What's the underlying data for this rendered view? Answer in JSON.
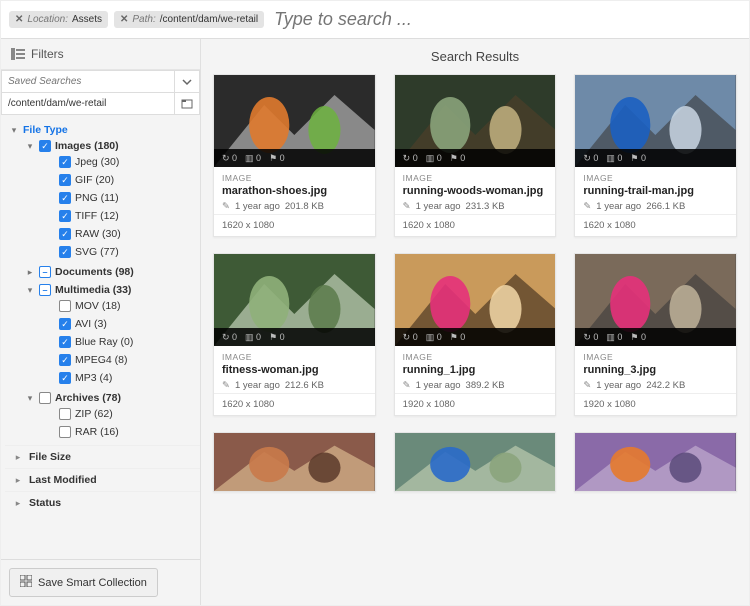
{
  "topbar": {
    "tags": [
      {
        "key": "Location",
        "value": "Assets"
      },
      {
        "key": "Path",
        "value": "/content/dam/we-retail"
      }
    ],
    "search_placeholder": "Type to search ..."
  },
  "sidebar": {
    "filters_label": "Filters",
    "saved_searches_placeholder": "Saved Searches",
    "path_value": "/content/dam/we-retail",
    "tree": {
      "file_type": {
        "label": "File Type",
        "images": {
          "label": "Images (180)",
          "checked": true,
          "children": [
            {
              "label": "Jpeg (30)",
              "checked": true
            },
            {
              "label": "GIF (20)",
              "checked": true
            },
            {
              "label": "PNG (11)",
              "checked": true
            },
            {
              "label": "TIFF (12)",
              "checked": true
            },
            {
              "label": "RAW (30)",
              "checked": true
            },
            {
              "label": "SVG (77)",
              "checked": true
            }
          ]
        },
        "documents": {
          "label": "Documents (98)",
          "mixed": true
        },
        "multimedia": {
          "label": "Multimedia (33)",
          "mixed": true,
          "children": [
            {
              "label": "MOV (18)",
              "checked": false
            },
            {
              "label": "AVI (3)",
              "checked": true
            },
            {
              "label": "Blue Ray (0)",
              "checked": true
            },
            {
              "label": "MPEG4 (8)",
              "checked": true
            },
            {
              "label": "MP3 (4)",
              "checked": true
            }
          ]
        },
        "archives": {
          "label": "Archives (78)",
          "checked": false,
          "children": [
            {
              "label": "ZIP (62)",
              "checked": false
            },
            {
              "label": "RAR (16)",
              "checked": false
            }
          ]
        }
      },
      "sections": [
        "File Size",
        "Last Modified",
        "Status"
      ]
    },
    "save_button": "Save Smart Collection"
  },
  "results": {
    "title": "Search Results",
    "eyebrow": "IMAGE",
    "qa_values": {
      "a": "0",
      "b": "0",
      "c": "0"
    },
    "cards": [
      {
        "name": "marathon-shoes.jpg",
        "age": "1 year ago",
        "size": "201.8 KB",
        "dims": "1620 x 1080",
        "palette": "run1"
      },
      {
        "name": "running-woods-woman.jpg",
        "age": "1 year ago",
        "size": "231.3 KB",
        "dims": "1620 x 1080",
        "palette": "run2"
      },
      {
        "name": "running-trail-man.jpg",
        "age": "1 year ago",
        "size": "266.1 KB",
        "dims": "1620 x 1080",
        "palette": "run3"
      },
      {
        "name": "fitness-woman.jpg",
        "age": "1 year ago",
        "size": "212.6 KB",
        "dims": "1620 x 1080",
        "palette": "run4"
      },
      {
        "name": "running_1.jpg",
        "age": "1 year ago",
        "size": "389.2 KB",
        "dims": "1920 x 1080",
        "palette": "run5"
      },
      {
        "name": "running_3.jpg",
        "age": "1 year ago",
        "size": "242.2 KB",
        "dims": "1920 x 1080",
        "palette": "run6"
      },
      {
        "name": "",
        "partial": true,
        "palette": "run7"
      },
      {
        "name": "",
        "partial": true,
        "palette": "run8"
      },
      {
        "name": "",
        "partial": true,
        "palette": "run9"
      }
    ]
  }
}
